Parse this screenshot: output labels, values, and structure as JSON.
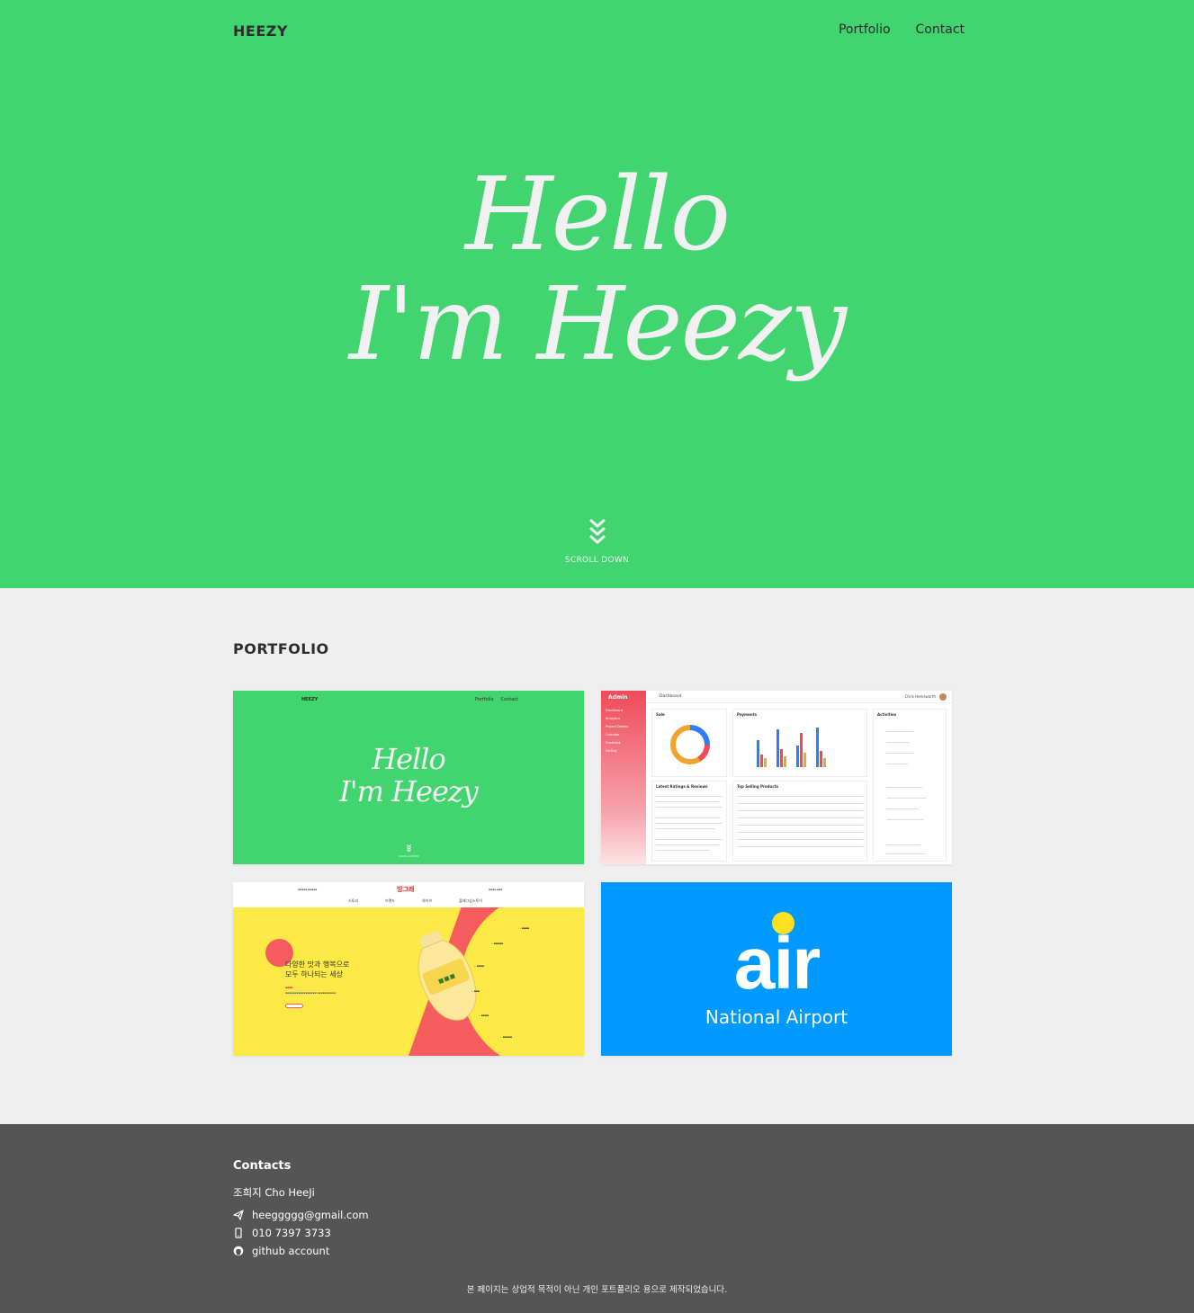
{
  "header": {
    "brand": "HEEZY",
    "nav": [
      "Portfolio",
      "Contact"
    ]
  },
  "hero": {
    "line1": "Hello",
    "line2": "I'm Heezy",
    "scroll_label": "SCROLL DOWN",
    "icon": "double-chevron-down-icon"
  },
  "portfolio": {
    "title": "PORTFOLIO",
    "cards": [
      {
        "name": "heezy-portfolio",
        "brand": "HEEZY",
        "nav": [
          "Portfolio",
          "Contact"
        ],
        "line1": "Hello",
        "line2": "I'm Heezy",
        "scroll_label": "SCROLL DOWN"
      },
      {
        "name": "admin-dashboard",
        "logo": "Admin",
        "topbar_title": "Dashboard",
        "user": "Chris Hemsworth",
        "panels": [
          "Sale",
          "Payments",
          "Activities",
          "Latest Ratings & Reviews",
          "Top Selling Products"
        ],
        "menu": [
          "Dashboard",
          "Analytics",
          "Project Details",
          "Calendar",
          "Feedback",
          "Setting"
        ]
      },
      {
        "name": "binggrae",
        "logo": "빙그레",
        "menu": [
          "스토리",
          "브랜드",
          "와이브",
          "플레그십스토어"
        ],
        "headline1": "다양한 맛과 행복으로",
        "headline2": "모두 하나되는 세상"
      },
      {
        "name": "air-national-airport",
        "word": "air",
        "subtitle": "National Airport"
      }
    ]
  },
  "footer": {
    "title": "Contacts",
    "name": "조희지 Cho HeeJi",
    "email": "heeggggg@gmail.com",
    "phone": "010 7397 3733",
    "github": "github account",
    "note": "본 페이지는 상업적 목적이 아닌 개인 포트폴리오 용으로 제작되었습니다."
  },
  "colors": {
    "hero_bg": "#42d46e",
    "page_bg": "#efefef",
    "footer_bg": "#555555",
    "air_blue": "#0099ff",
    "air_dot": "#ffe21f",
    "banana_yellow": "#fde946",
    "banana_red": "#f55c5e"
  }
}
